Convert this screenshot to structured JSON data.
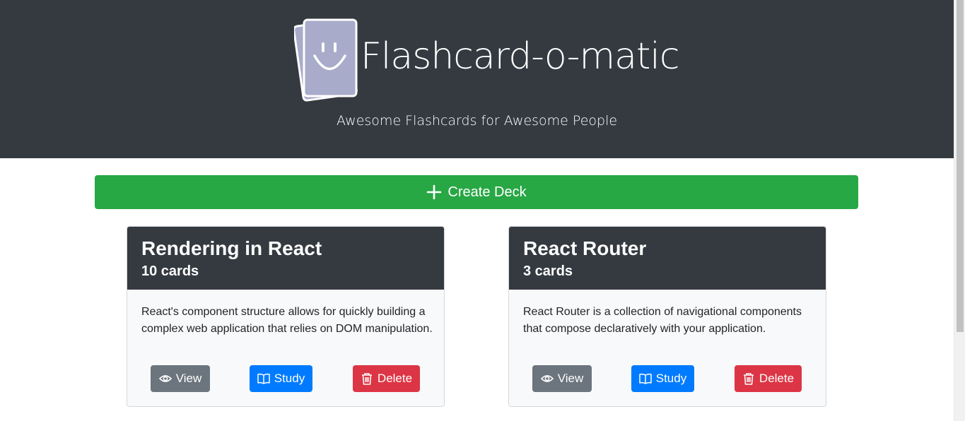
{
  "header": {
    "title": "Flashcard-o-matic",
    "subtitle": "Awesome Flashcards for Awesome People",
    "logo_icon": "smiley-flashcard-icon",
    "background": "#343a40"
  },
  "actions": {
    "create_deck_label": "Create Deck",
    "create_deck_icon": "plus-icon",
    "create_deck_color": "#28a745"
  },
  "decks": [
    {
      "name": "Rendering in React",
      "count": "10 cards",
      "description": "React's component structure allows for quickly building a complex web application that relies on DOM manipulation.",
      "view_label": "View",
      "study_label": "Study",
      "delete_label": "Delete"
    },
    {
      "name": "React Router",
      "count": "3 cards",
      "description": "React Router is a collection of navigational components that compose declaratively with your application.",
      "view_label": "View",
      "study_label": "Study",
      "delete_label": "Delete"
    }
  ],
  "buttons": {
    "view_icon": "eye-icon",
    "study_icon": "book-icon",
    "delete_icon": "trash-icon",
    "view_color": "#6c757d",
    "study_color": "#007bff",
    "delete_color": "#dc3545"
  }
}
